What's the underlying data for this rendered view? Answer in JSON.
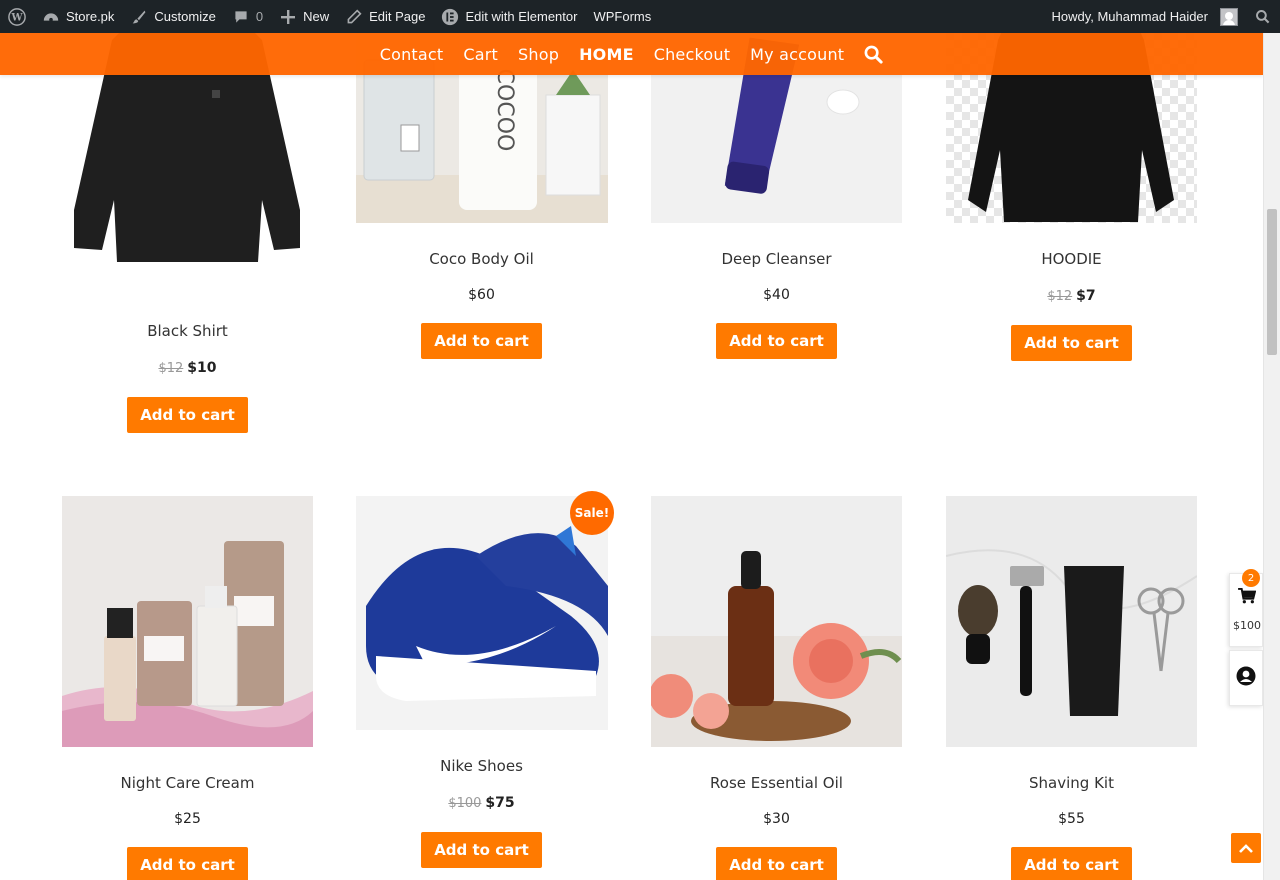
{
  "adminbar": {
    "site_name": "Store.pk",
    "customize": "Customize",
    "comments_count": "0",
    "new_label": "New",
    "edit_page": "Edit Page",
    "edit_elementor": "Edit with Elementor",
    "wpforms": "WPForms",
    "howdy": "Howdy, Muhammad Haider"
  },
  "nav": {
    "items": [
      "Contact",
      "Cart",
      "Shop",
      "HOME",
      "Checkout",
      "My account"
    ],
    "active": "HOME"
  },
  "products": [
    {
      "name": "Black Shirt",
      "old_price": "$12",
      "price": "$10",
      "button": "Add to cart"
    },
    {
      "name": "Coco Body Oil",
      "price": "$60",
      "button": "Add to cart"
    },
    {
      "name": "Deep Cleanser",
      "price": "$40",
      "button": "Add to cart"
    },
    {
      "name": "HOODIE",
      "old_price": "$12",
      "price": "$7",
      "button": "Add to cart"
    },
    {
      "name": "Night Care Cream",
      "price": "$25",
      "button": "Add to cart"
    },
    {
      "name": "Nike Shoes",
      "old_price": "$100",
      "price": "$75",
      "button": "Add to cart",
      "badge": "Sale!"
    },
    {
      "name": "Rose Essential Oil",
      "price": "$30",
      "button": "Add to cart"
    },
    {
      "name": "Shaving Kit",
      "price": "$55",
      "button": "Add to cart"
    }
  ],
  "side_cart": {
    "count": "2",
    "total": "$100"
  },
  "colors": {
    "accent": "#ff7a00",
    "nav_bg": "#ff6600",
    "adminbar_bg": "#1d2327"
  }
}
